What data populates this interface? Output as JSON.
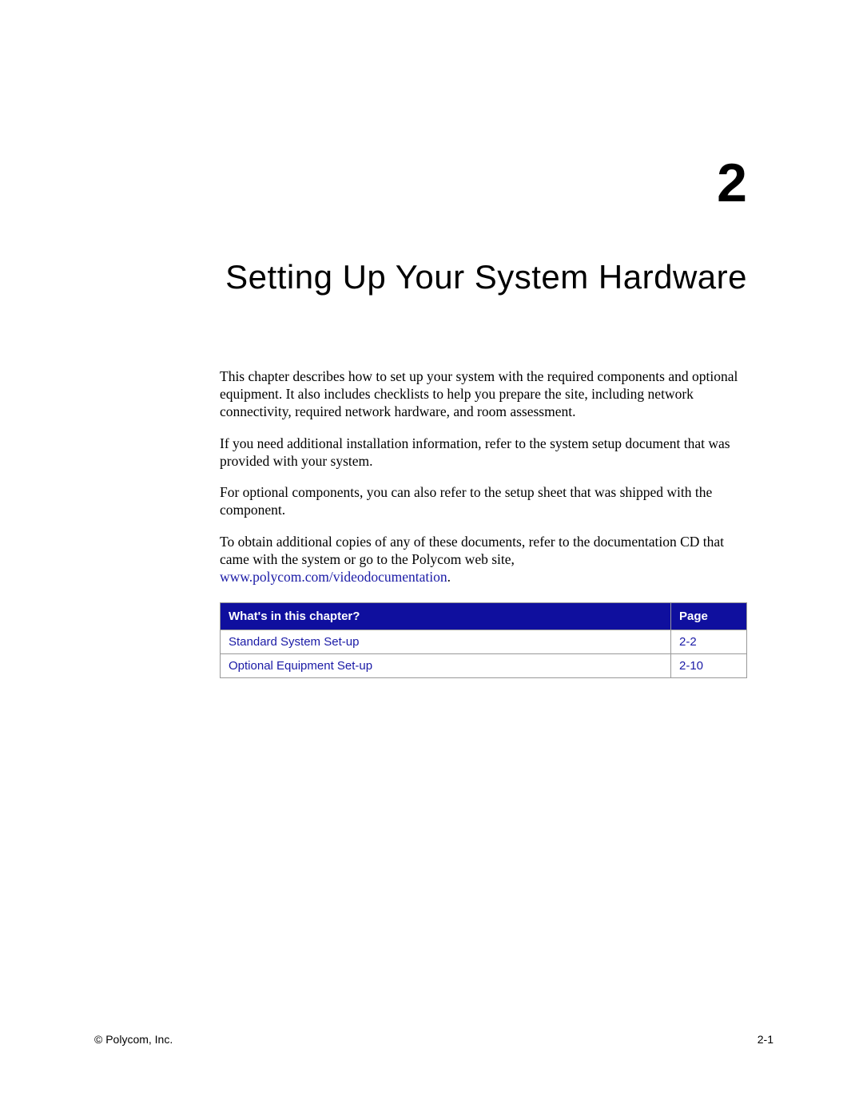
{
  "chapter": {
    "number": "2",
    "title": "Setting Up Your System Hardware"
  },
  "paragraphs": {
    "p1": "This chapter describes how to set up your system with the required components and optional equipment. It also includes checklists to help you prepare the site, including network connectivity, required network hardware, and room assessment.",
    "p2": "If you need additional installation information, refer to the system setup document that was provided with your system.",
    "p3": "For optional components, you can also refer to the setup sheet that was shipped with the component.",
    "p4_part1": "To obtain additional copies of any of these documents, refer to the documentation CD that came with the system or go to the Polycom web site, ",
    "p4_link": "www.polycom.com/videodocumentation",
    "p4_part2": "."
  },
  "toc": {
    "header_title": "What's in this chapter?",
    "header_page": "Page",
    "rows": [
      {
        "title": "Standard System Set-up",
        "page": "2-2"
      },
      {
        "title": "Optional Equipment Set-up",
        "page": "2-10"
      }
    ]
  },
  "footer": {
    "copyright": "© Polycom, Inc.",
    "page_number": "2-1"
  }
}
